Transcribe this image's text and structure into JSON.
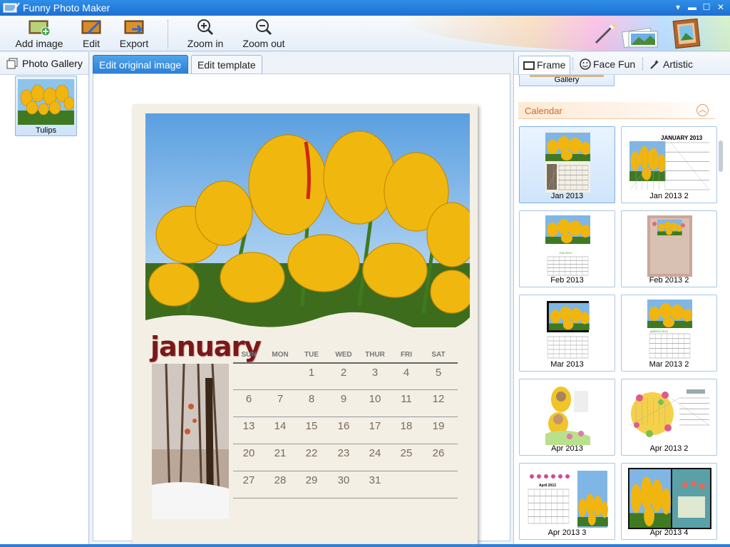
{
  "window": {
    "title": "Funny Photo Maker"
  },
  "toolbar": {
    "add_image": "Add image",
    "edit": "Edit",
    "export": "Export",
    "zoom_in": "Zoom in",
    "zoom_out": "Zoom out"
  },
  "left_panel": {
    "header": "Photo Gallery",
    "items": [
      {
        "label": "Tulips"
      }
    ]
  },
  "center_panel": {
    "tabs": [
      {
        "label": "Edit original image",
        "active": true
      },
      {
        "label": "Edit template",
        "active": false
      }
    ],
    "calendar": {
      "month": "january",
      "weekdays": [
        "SUN",
        "MON",
        "TUE",
        "WED",
        "THUR",
        "FRI",
        "SAT"
      ],
      "weeks": [
        [
          "",
          "",
          "1",
          "2",
          "3",
          "4",
          "5"
        ],
        [
          "6",
          "7",
          "8",
          "9",
          "10",
          "11",
          "12"
        ],
        [
          "13",
          "14",
          "15",
          "16",
          "17",
          "18",
          "19"
        ],
        [
          "20",
          "21",
          "22",
          "23",
          "24",
          "25",
          "26"
        ],
        [
          "27",
          "28",
          "29",
          "30",
          "31",
          "",
          ""
        ]
      ]
    }
  },
  "right_panel": {
    "tabs": [
      {
        "label": "Frame",
        "active": true
      },
      {
        "label": "Face Fun"
      },
      {
        "label": "Artistic"
      }
    ],
    "gallery_stub": "Gallery",
    "section": "Calendar",
    "templates": [
      {
        "label": "Jan 2013",
        "selected": true
      },
      {
        "label": "Jan 2013 2"
      },
      {
        "label": "Feb 2013"
      },
      {
        "label": "Feb 2013 2"
      },
      {
        "label": "Mar 2013"
      },
      {
        "label": "Mar 2013 2"
      },
      {
        "label": "Apr 2013"
      },
      {
        "label": "Apr 2013 2"
      },
      {
        "label": "Apr 2013 3"
      },
      {
        "label": "Apr 2013 4"
      }
    ],
    "template_text": {
      "jan2": "JANUARY 2013",
      "apr3": "April 2013"
    }
  },
  "colors": {
    "accent": "#2b7fd6",
    "section_text": "#d26a1a",
    "month_text": "#7a1818"
  },
  "icons": [
    "app-icon",
    "add-image-icon",
    "edit-icon",
    "export-icon",
    "zoom-in-icon",
    "zoom-out-icon",
    "magic-wand-icon",
    "photos-icon",
    "frame-icon",
    "gallery-icon",
    "face-icon",
    "artistic-icon",
    "collapse-icon"
  ]
}
